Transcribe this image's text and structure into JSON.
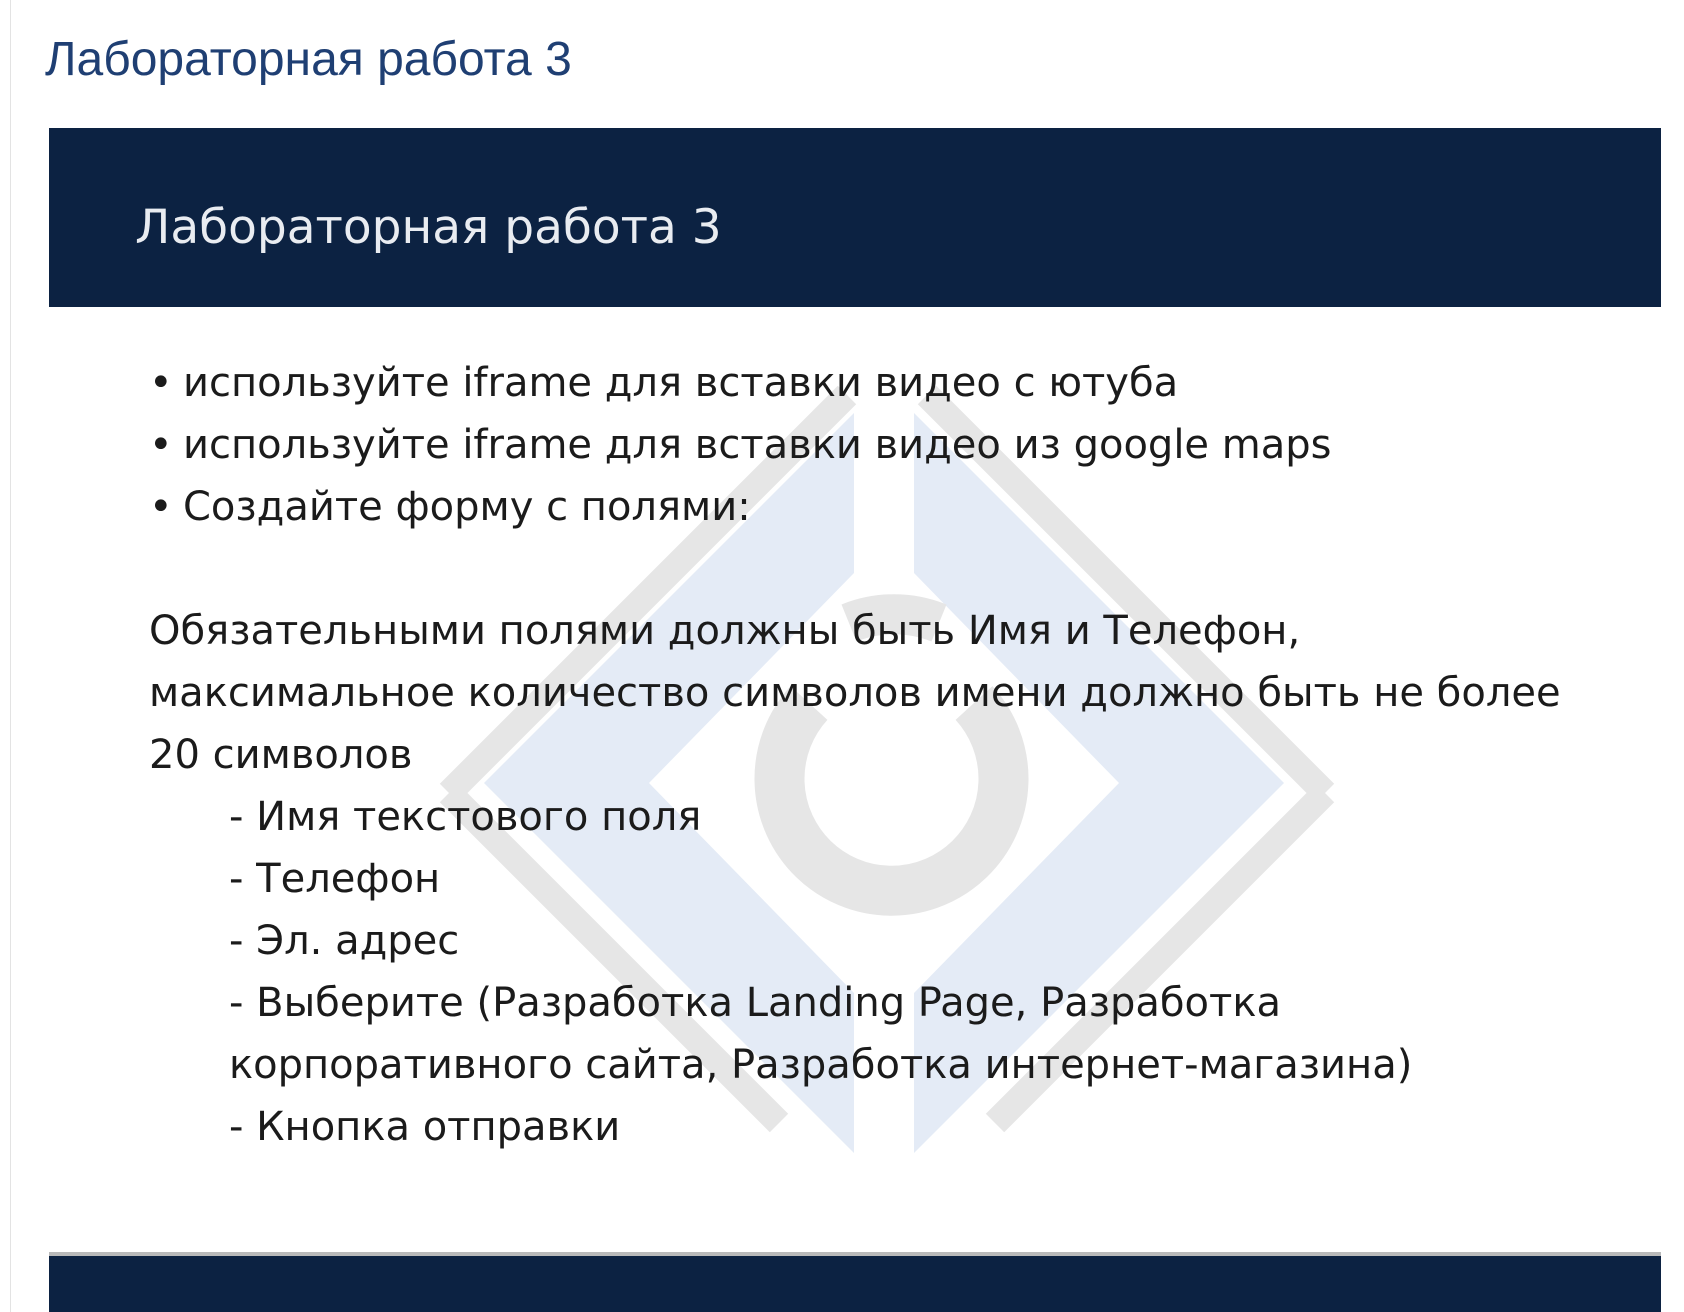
{
  "page": {
    "title": "Лабораторная работа 3"
  },
  "slide": {
    "title": "Лабораторная работа 3",
    "bullet_glyph": "•",
    "bullets": [
      "используйте iframe для вставки видео с ютуба",
      "используйте iframe для вставки видео из google maps",
      "Создайте форму с полями:"
    ],
    "note": "Обязательными полями должны быть Имя и Телефон, максимальное количество символов имени должно быть не более 20 символов",
    "fields": [
      "- Имя текстового поля",
      "- Телефон",
      "- Эл. адрес",
      "- Выберите (Разработка Landing Page, Разработка корпоративного сайта, Разработка интернет-магазина)",
      "- Кнопка отправки"
    ]
  },
  "colors": {
    "page_title": "#1f3f73",
    "slide_header_bg": "#0c2242",
    "slide_title": "#e9ecf1",
    "body_text": "#1b1b1b",
    "watermark_blue": "#e4ebf6",
    "watermark_gray": "#e6e6e6"
  },
  "icons": {
    "watermark": "university-logo-icon"
  }
}
